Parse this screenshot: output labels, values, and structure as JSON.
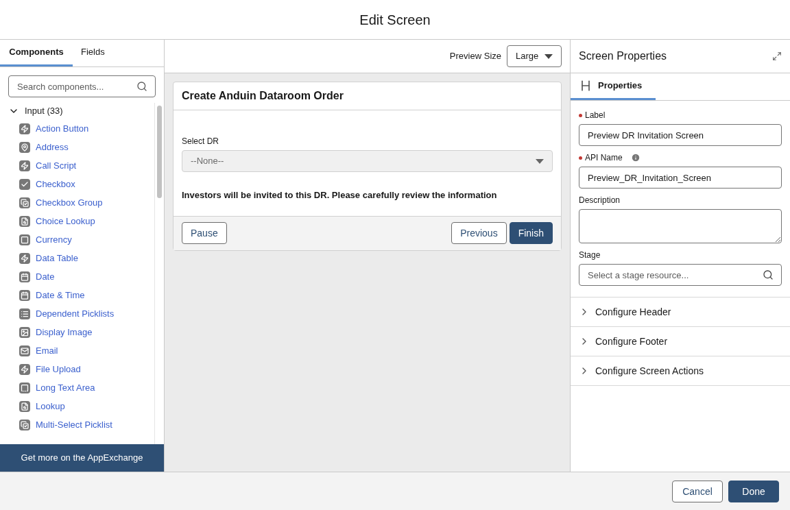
{
  "window": {
    "title": "Edit Screen"
  },
  "left_panel": {
    "tabs": [
      {
        "label": "Components",
        "selected": true
      },
      {
        "label": "Fields",
        "selected": false
      }
    ],
    "search": {
      "placeholder": "Search components..."
    },
    "group": {
      "label": "Input (33)",
      "expanded": true
    },
    "items": [
      {
        "label": "Action Button",
        "kind": "bolt"
      },
      {
        "label": "Address",
        "kind": "pin"
      },
      {
        "label": "Call Script",
        "kind": "bolt"
      },
      {
        "label": "Checkbox",
        "kind": "check"
      },
      {
        "label": "Checkbox Group",
        "kind": "checkgroup"
      },
      {
        "label": "Choice Lookup",
        "kind": "lookup"
      },
      {
        "label": "Currency",
        "kind": "currency"
      },
      {
        "label": "Data Table",
        "kind": "bolt"
      },
      {
        "label": "Date",
        "kind": "calendar"
      },
      {
        "label": "Date & Time",
        "kind": "calendar"
      },
      {
        "label": "Dependent Picklists",
        "kind": "list"
      },
      {
        "label": "Display Image",
        "kind": "image"
      },
      {
        "label": "Email",
        "kind": "mail"
      },
      {
        "label": "File Upload",
        "kind": "bolt"
      },
      {
        "label": "Long Text Area",
        "kind": "textarea"
      },
      {
        "label": "Lookup",
        "kind": "lookup"
      },
      {
        "label": "Multi-Select Picklist",
        "kind": "checkgroup"
      }
    ],
    "appexchange_button": "Get more on the AppExchange"
  },
  "canvas": {
    "preview_size_label": "Preview Size",
    "preview_size_value": "Large",
    "screen": {
      "title": "Create Anduin Dataroom Order",
      "select_label": "Select DR",
      "select_value": "--None--",
      "message": "Investors will be invited to this DR. Please carefully review the information",
      "buttons": [
        {
          "label": "Pause",
          "kind": "outline"
        },
        {
          "label": "Previous",
          "kind": "outline"
        },
        {
          "label": "Finish",
          "kind": "brand"
        }
      ]
    }
  },
  "properties": {
    "title": "Screen Properties",
    "tab": {
      "label": "Properties",
      "selected": true
    },
    "fields": [
      {
        "label": "Label",
        "required": true,
        "info": false,
        "kind": "input",
        "value": "Preview DR Invitation Screen"
      },
      {
        "label": "API Name",
        "required": true,
        "info": true,
        "kind": "input",
        "value": "Preview_DR_Invitation_Screen"
      },
      {
        "label": "Description",
        "required": false,
        "info": false,
        "kind": "textarea"
      },
      {
        "label": "Stage",
        "required": false,
        "info": false,
        "kind": "search",
        "placeholder": "Select a stage resource..."
      }
    ],
    "sections": [
      {
        "label": "Configure Header",
        "expanded": false
      },
      {
        "label": "Configure Footer",
        "expanded": false
      },
      {
        "label": "Configure Screen Actions",
        "expanded": false
      }
    ]
  },
  "footer": {
    "buttons": [
      {
        "label": "Cancel",
        "kind": "outline"
      },
      {
        "label": "Done",
        "kind": "brand"
      }
    ]
  }
}
